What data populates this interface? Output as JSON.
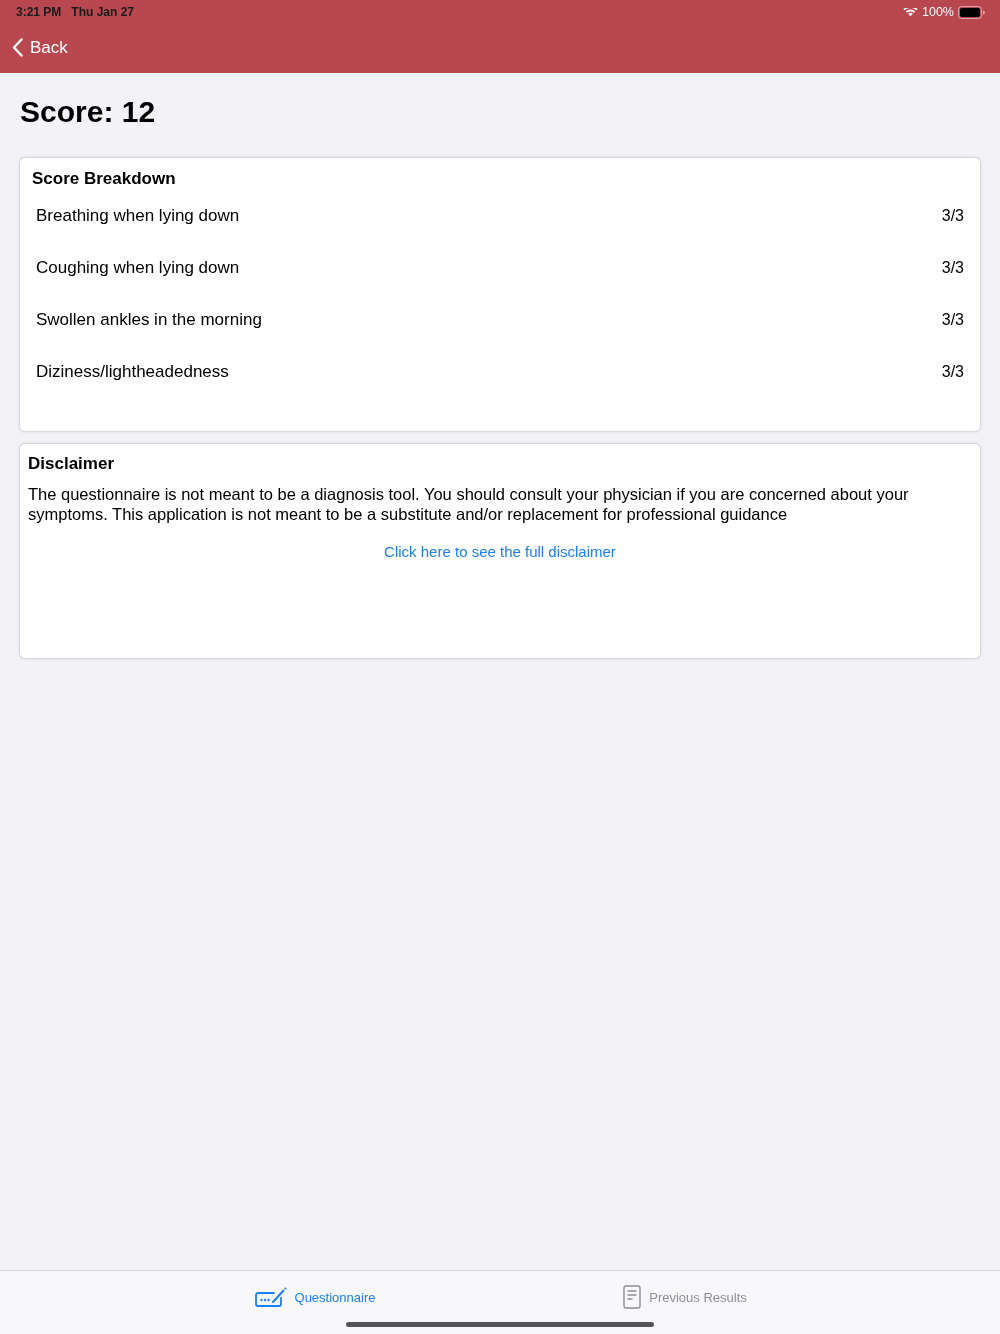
{
  "status_bar": {
    "time": "3:21 PM",
    "date": "Thu Jan 27",
    "battery": "100%"
  },
  "nav": {
    "back": "Back"
  },
  "score": "Score: 12",
  "breakdown": {
    "title": "Score Breakdown",
    "rows": [
      {
        "label": "Breathing when lying down",
        "value": "3/3"
      },
      {
        "label": "Coughing when lying down",
        "value": "3/3"
      },
      {
        "label": "Swollen ankles in the morning",
        "value": "3/3"
      },
      {
        "label": "Diziness/lightheadedness",
        "value": "3/3"
      }
    ]
  },
  "disclaimer": {
    "title": "Disclaimer",
    "text": "The questionnaire is not meant to be a diagnosis tool. You should consult your physician if you are concerned about your symptoms. This application is not meant to be a substitute and/or replacement for professional guidance",
    "link": "Click here to see the full disclaimer"
  },
  "tab_bar": {
    "tabs": [
      {
        "label": "Questionnaire",
        "selected": true,
        "kind": "questionnaire"
      },
      {
        "label": "Previous Results",
        "selected": false,
        "kind": "results"
      }
    ]
  }
}
